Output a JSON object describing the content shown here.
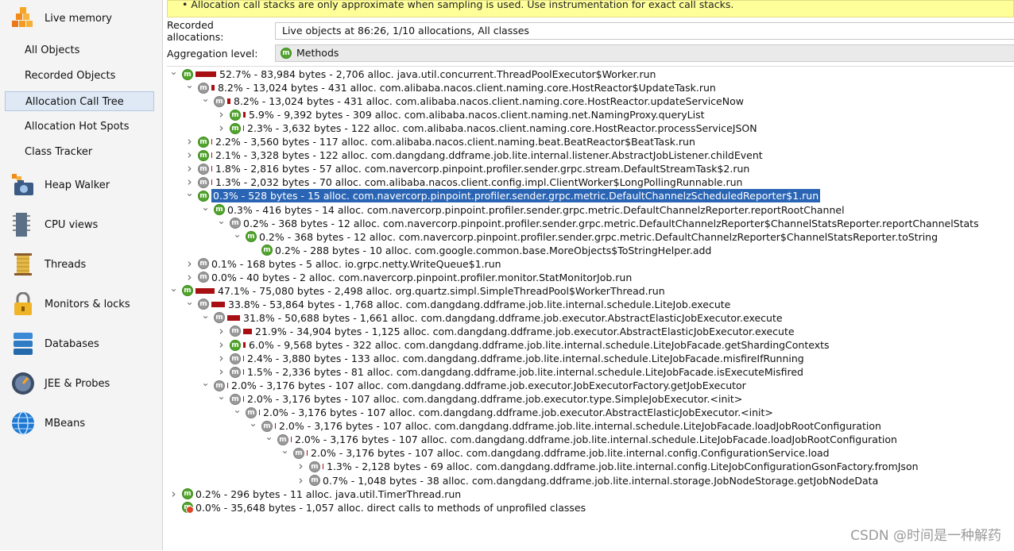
{
  "sidebar": {
    "sections": [
      {
        "label": "Live memory",
        "icon": "live-memory-icon"
      },
      {
        "label": "Heap Walker",
        "icon": "heap-walker-icon"
      },
      {
        "label": "CPU views",
        "icon": "cpu-views-icon"
      },
      {
        "label": "Threads",
        "icon": "threads-icon"
      },
      {
        "label": "Monitors & locks",
        "icon": "lock-icon"
      },
      {
        "label": "Databases",
        "icon": "databases-icon"
      },
      {
        "label": "JEE & Probes",
        "icon": "probes-icon"
      },
      {
        "label": "MBeans",
        "icon": "mbeans-icon"
      }
    ],
    "live_memory_items": [
      {
        "label": "All Objects"
      },
      {
        "label": "Recorded Objects"
      },
      {
        "label": "Allocation Call Tree"
      },
      {
        "label": "Allocation Hot Spots"
      },
      {
        "label": "Class Tracker"
      }
    ]
  },
  "notice": {
    "text": "• Allocation call stacks are only approximate when sampling is used. Use instrumentation for exact call stacks."
  },
  "recorded": {
    "label": "Recorded allocations:",
    "value": "Live objects at 86:26, 1/10 allocations, All classes"
  },
  "aggregation": {
    "label": "Aggregation level:",
    "value": "Methods"
  },
  "tree": [
    {
      "depth": 0,
      "exp": "open",
      "icon": "green",
      "pct": 52.7,
      "text": "52.7% - 83,984 bytes - 2,706 alloc. java.util.concurrent.ThreadPoolExecutor$Worker.run"
    },
    {
      "depth": 1,
      "exp": "open",
      "icon": "gray",
      "pct": 8.2,
      "text": "8.2% - 13,024 bytes - 431 alloc. com.alibaba.nacos.client.naming.core.HostReactor$UpdateTask.run"
    },
    {
      "depth": 2,
      "exp": "open",
      "icon": "gray",
      "pct": 8.2,
      "text": "8.2% - 13,024 bytes - 431 alloc. com.alibaba.nacos.client.naming.core.HostReactor.updateServiceNow"
    },
    {
      "depth": 3,
      "exp": "closed",
      "icon": "green",
      "pct": 5.9,
      "text": "5.9% - 9,392 bytes - 309 alloc. com.alibaba.nacos.client.naming.net.NamingProxy.queryList"
    },
    {
      "depth": 3,
      "exp": "closed",
      "icon": "green",
      "pct": 2.3,
      "text": "2.3% - 3,632 bytes - 122 alloc. com.alibaba.nacos.client.naming.core.HostReactor.processServiceJSON"
    },
    {
      "depth": 1,
      "exp": "closed",
      "icon": "green",
      "pct": 2.2,
      "text": "2.2% - 3,560 bytes - 117 alloc. com.alibaba.nacos.client.naming.beat.BeatReactor$BeatTask.run"
    },
    {
      "depth": 1,
      "exp": "closed",
      "icon": "green",
      "pct": 2.1,
      "text": "2.1% - 3,328 bytes - 122 alloc. com.dangdang.ddframe.job.lite.internal.listener.AbstractJobListener.childEvent"
    },
    {
      "depth": 1,
      "exp": "closed",
      "icon": "gray",
      "pct": 1.8,
      "text": "1.8% - 2,816 bytes - 57 alloc. com.navercorp.pinpoint.profiler.sender.grpc.stream.DefaultStreamTask$2.run"
    },
    {
      "depth": 1,
      "exp": "closed",
      "icon": "gray",
      "pct": 1.3,
      "text": "1.3% - 2,032 bytes - 70 alloc. com.alibaba.nacos.client.config.impl.ClientWorker$LongPollingRunnable.run"
    },
    {
      "depth": 1,
      "exp": "open",
      "icon": "green",
      "pct": 0.3,
      "text": "0.3% - 528 bytes - 15 alloc. com.navercorp.pinpoint.profiler.sender.grpc.metric.DefaultChannelzScheduledReporter$1.run",
      "selected": true
    },
    {
      "depth": 2,
      "exp": "open",
      "icon": "green",
      "pct": 0.3,
      "text": "0.3% - 416 bytes - 14 alloc. com.navercorp.pinpoint.profiler.sender.grpc.metric.DefaultChannelzReporter.reportRootChannel"
    },
    {
      "depth": 3,
      "exp": "open",
      "icon": "gray",
      "pct": 0.2,
      "text": "0.2% - 368 bytes - 12 alloc. com.navercorp.pinpoint.profiler.sender.grpc.metric.DefaultChannelzReporter$ChannelStatsReporter.reportChannelStats"
    },
    {
      "depth": 4,
      "exp": "open",
      "icon": "green",
      "pct": 0.2,
      "text": "0.2% - 368 bytes - 12 alloc. com.navercorp.pinpoint.profiler.sender.grpc.metric.DefaultChannelzReporter$ChannelStatsReporter.toString"
    },
    {
      "depth": 5,
      "exp": "none",
      "icon": "green",
      "pct": 0.2,
      "text": "0.2% - 288 bytes - 10 alloc. com.google.common.base.MoreObjects$ToStringHelper.add"
    },
    {
      "depth": 1,
      "exp": "closed",
      "icon": "gray",
      "pct": 0.1,
      "text": "0.1% - 168 bytes - 5 alloc. io.grpc.netty.WriteQueue$1.run"
    },
    {
      "depth": 1,
      "exp": "closed",
      "icon": "gray",
      "pct": 0.0,
      "text": "0.0% - 40 bytes - 2 alloc. com.navercorp.pinpoint.profiler.monitor.StatMonitorJob.run"
    },
    {
      "depth": 0,
      "exp": "open",
      "icon": "green",
      "pct": 47.1,
      "text": "47.1% - 75,080 bytes - 2,498 alloc. org.quartz.simpl.SimpleThreadPool$WorkerThread.run"
    },
    {
      "depth": 1,
      "exp": "open",
      "icon": "gray",
      "pct": 33.8,
      "text": "33.8% - 53,864 bytes - 1,768 alloc. com.dangdang.ddframe.job.lite.internal.schedule.LiteJob.execute"
    },
    {
      "depth": 2,
      "exp": "open",
      "icon": "gray",
      "pct": 31.8,
      "text": "31.8% - 50,688 bytes - 1,661 alloc. com.dangdang.ddframe.job.executor.AbstractElasticJobExecutor.execute"
    },
    {
      "depth": 3,
      "exp": "closed",
      "icon": "gray",
      "pct": 21.9,
      "text": "21.9% - 34,904 bytes - 1,125 alloc. com.dangdang.ddframe.job.executor.AbstractElasticJobExecutor.execute"
    },
    {
      "depth": 3,
      "exp": "closed",
      "icon": "green",
      "pct": 6.0,
      "text": "6.0% - 9,568 bytes - 322 alloc. com.dangdang.ddframe.job.lite.internal.schedule.LiteJobFacade.getShardingContexts"
    },
    {
      "depth": 3,
      "exp": "closed",
      "icon": "gray",
      "pct": 2.4,
      "text": "2.4% - 3,880 bytes - 133 alloc. com.dangdang.ddframe.job.lite.internal.schedule.LiteJobFacade.misfireIfRunning"
    },
    {
      "depth": 3,
      "exp": "closed",
      "icon": "gray",
      "pct": 1.5,
      "text": "1.5% - 2,336 bytes - 81 alloc. com.dangdang.ddframe.job.lite.internal.schedule.LiteJobFacade.isExecuteMisfired"
    },
    {
      "depth": 2,
      "exp": "open",
      "icon": "gray",
      "pct": 2.0,
      "text": "2.0% - 3,176 bytes - 107 alloc. com.dangdang.ddframe.job.executor.JobExecutorFactory.getJobExecutor"
    },
    {
      "depth": 3,
      "exp": "open",
      "icon": "gray",
      "pct": 2.0,
      "text": "2.0% - 3,176 bytes - 107 alloc. com.dangdang.ddframe.job.executor.type.SimpleJobExecutor.<init>"
    },
    {
      "depth": 4,
      "exp": "open",
      "icon": "gray",
      "pct": 2.0,
      "text": "2.0% - 3,176 bytes - 107 alloc. com.dangdang.ddframe.job.executor.AbstractElasticJobExecutor.<init>"
    },
    {
      "depth": 5,
      "exp": "open",
      "icon": "gray",
      "pct": 2.0,
      "text": "2.0% - 3,176 bytes - 107 alloc. com.dangdang.ddframe.job.lite.internal.schedule.LiteJobFacade.loadJobRootConfiguration"
    },
    {
      "depth": 6,
      "exp": "open",
      "icon": "gray",
      "pct": 2.0,
      "text": "2.0% - 3,176 bytes - 107 alloc. com.dangdang.ddframe.job.lite.internal.schedule.LiteJobFacade.loadJobRootConfiguration"
    },
    {
      "depth": 7,
      "exp": "open",
      "icon": "gray",
      "pct": 2.0,
      "text": "2.0% - 3,176 bytes - 107 alloc. com.dangdang.ddframe.job.lite.internal.config.ConfigurationService.load"
    },
    {
      "depth": 8,
      "exp": "closed",
      "icon": "gray",
      "pct": 1.3,
      "text": "1.3% - 2,128 bytes - 69 alloc. com.dangdang.ddframe.job.lite.internal.config.LiteJobConfigurationGsonFactory.fromJson"
    },
    {
      "depth": 8,
      "exp": "closed",
      "icon": "gray",
      "pct": 0.7,
      "text": "0.7% - 1,048 bytes - 38 alloc. com.dangdang.ddframe.job.lite.internal.storage.JobNodeStorage.getJobNodeData"
    },
    {
      "depth": 0,
      "exp": "closed",
      "icon": "green",
      "pct": 0.2,
      "text": "0.2% - 296 bytes - 11 alloc. java.util.TimerThread.run"
    },
    {
      "depth": 0,
      "exp": "none",
      "icon": "noprof",
      "pct": 0.0,
      "text": "0.0% - 35,648 bytes - 1,057 alloc. direct calls to methods of unprofiled classes"
    }
  ],
  "watermark": "CSDN @时间是一种解药"
}
